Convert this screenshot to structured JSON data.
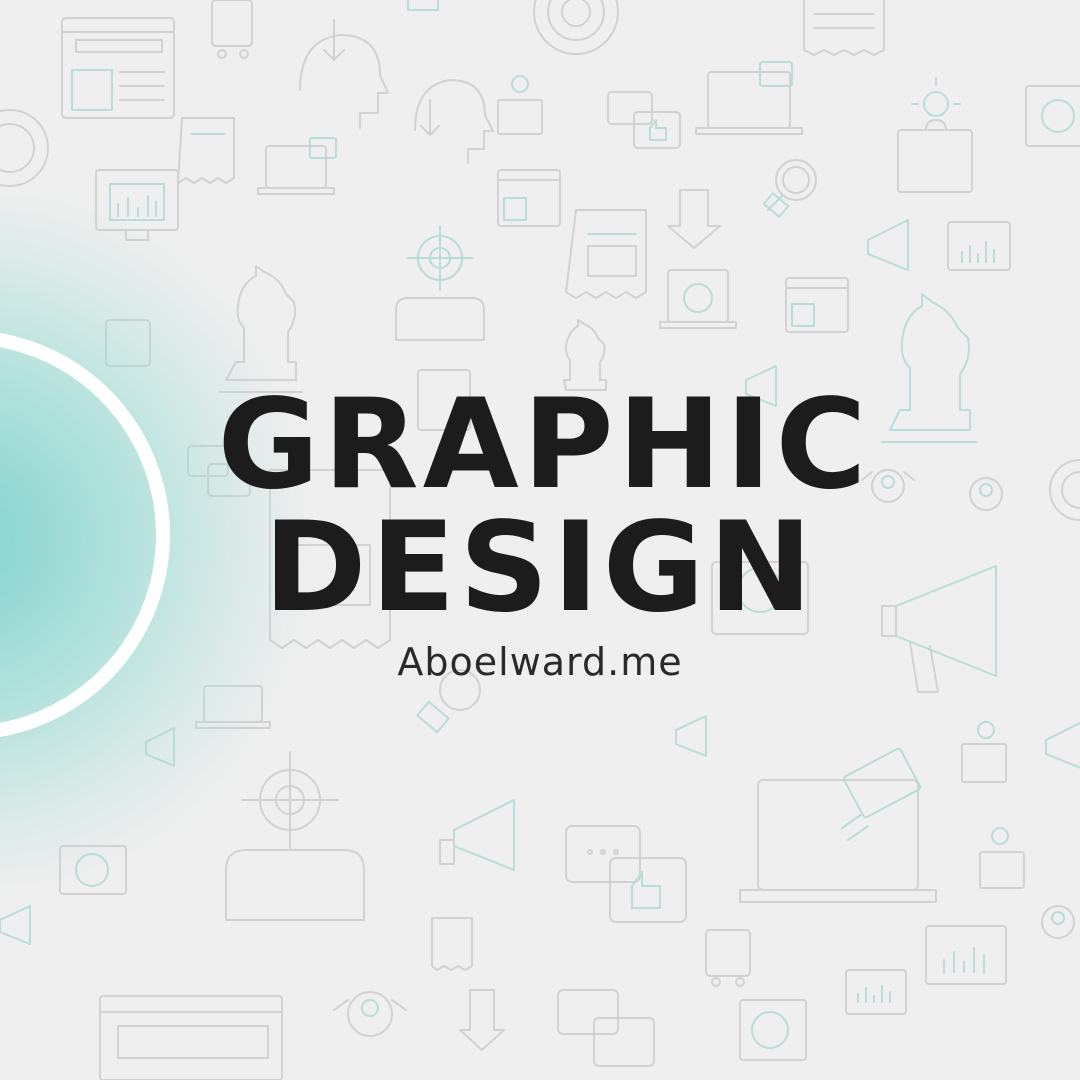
{
  "poster": {
    "title_line_1": "GRAPHIC",
    "title_line_2": "DESIGN",
    "website": "Aboelward.me"
  },
  "colors": {
    "background": "#efefef",
    "accent_teal": "#7fd3cc",
    "icon_gray": "#cfcfcf",
    "icon_teal": "#a9dcd6",
    "text": "#1c1c1c"
  },
  "icons": [
    "browser-window-icon",
    "hand-pointer-icon",
    "target-icon",
    "receipt-icon",
    "head-arrow-icon",
    "lightbulb-puzzle-icon",
    "chat-thumbs-up-icon",
    "laptop-mail-icon",
    "monitor-chart-icon",
    "chess-knight-icon",
    "megaphone-icon",
    "magnifier-icon",
    "network-laptop-icon",
    "user-search-icon"
  ]
}
